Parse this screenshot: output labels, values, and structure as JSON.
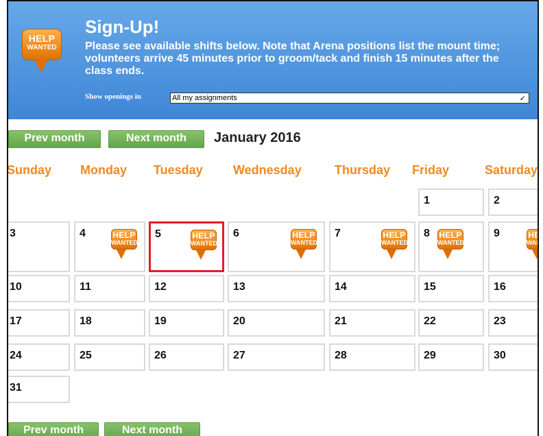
{
  "header": {
    "title": "Sign-Up!",
    "description": "Please see available shifts below. Note that Arena positions list the mount time; volunteers arrive 45 minutes prior to groom/tack and finish 15 minutes after the class ends.",
    "show_label": "Show openings in",
    "select_value": "All my assignments",
    "badge_line1": "HELP",
    "badge_line2": "WANTED",
    "colors": {
      "header_top": "#66a8e8",
      "header_bottom": "#3f86d6",
      "accent_orange": "#f08a21",
      "button_green": "#6aab4f"
    }
  },
  "navigation": {
    "prev_label": "Prev month",
    "next_label": "Next month",
    "month_title": "January 2016"
  },
  "calendar": {
    "days_of_week": [
      "Sunday",
      "Monday",
      "Tuesday",
      "Wednesday",
      "Thursday",
      "Friday",
      "Saturday"
    ],
    "weeks": [
      [
        "",
        "",
        "",
        "",
        "",
        "1",
        "2"
      ],
      [
        "3",
        "4",
        "5",
        "6",
        "7",
        "8",
        "9"
      ],
      [
        "10",
        "11",
        "12",
        "13",
        "14",
        "15",
        "16"
      ],
      [
        "17",
        "18",
        "19",
        "20",
        "21",
        "22",
        "23"
      ],
      [
        "24",
        "25",
        "26",
        "27",
        "28",
        "29",
        "30"
      ],
      [
        "31",
        "",
        "",
        "",
        "",
        "",
        ""
      ]
    ],
    "help_wanted_days": [
      "4",
      "5",
      "6",
      "7",
      "8",
      "9"
    ],
    "selected_day": "5"
  }
}
